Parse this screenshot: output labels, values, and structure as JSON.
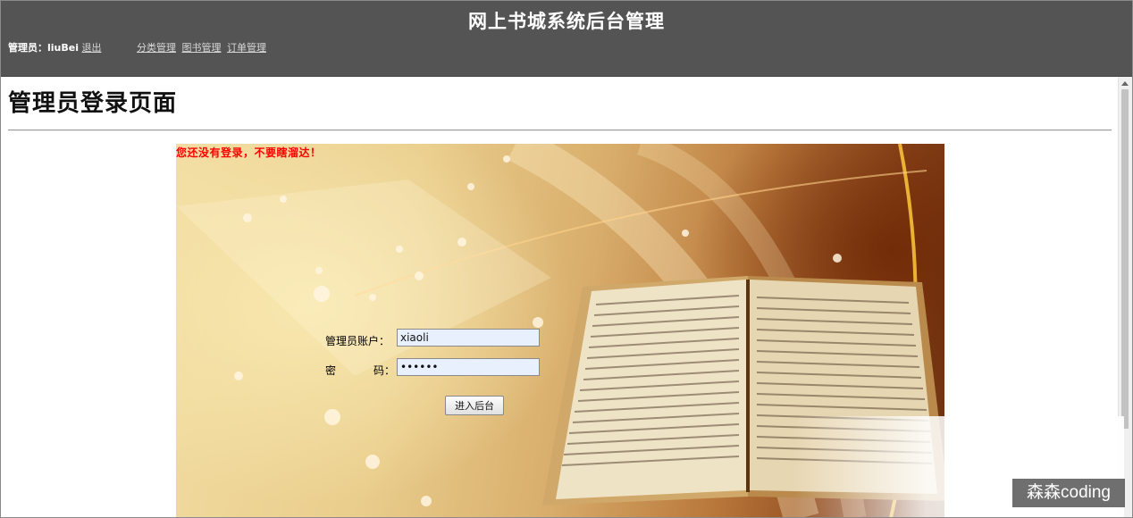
{
  "header": {
    "title": "网上书城系统后台管理",
    "admin_label": "管理员：liuBei",
    "logout": "退出",
    "nav": [
      "分类管理",
      "图书管理",
      "订单管理"
    ]
  },
  "page": {
    "title": "管理员登录页面"
  },
  "login": {
    "alert": "您还没有登录，不要瞎溜达！",
    "account_label": "管理员账户：",
    "account_value": "xiaoli",
    "password_label_a": "密",
    "password_label_b": "码：",
    "password_value": "••••••",
    "submit": "进入后台"
  },
  "watermark": "森森coding",
  "colors": {
    "header_bg": "#545454",
    "alert": "#ff0000",
    "input_bg": "#e8f0fe"
  }
}
